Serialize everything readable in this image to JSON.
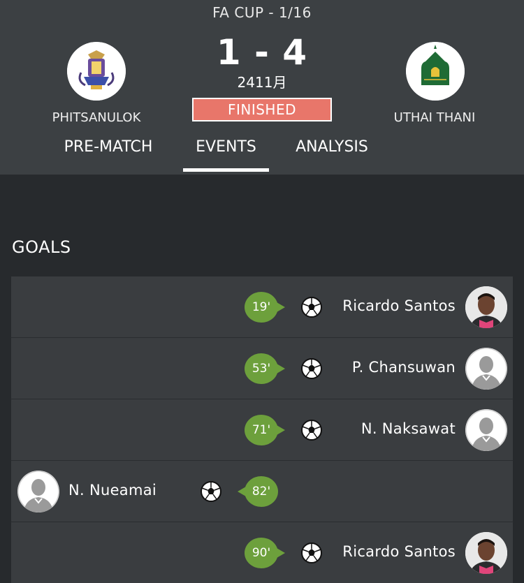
{
  "header": {
    "competition": "FA CUP - 1/16",
    "score": "1 - 4",
    "date": "2411月",
    "status": "FINISHED",
    "home_team": "PHITSANULOK",
    "away_team": "UTHAI THANI"
  },
  "tabs": [
    {
      "label": "PRE-MATCH"
    },
    {
      "label": "EVENTS",
      "active": true
    },
    {
      "label": "ANALYSIS"
    }
  ],
  "goals_title": "GOALS",
  "goals": [
    {
      "minute": "19'",
      "player": "Ricardo Santos",
      "side": "away",
      "avatar": "player-photo"
    },
    {
      "minute": "53'",
      "player": "P. Chansuwan",
      "side": "away",
      "avatar": "placeholder"
    },
    {
      "minute": "71'",
      "player": "N. Naksawat",
      "side": "away",
      "avatar": "placeholder"
    },
    {
      "minute": "82'",
      "player": "N. Nueamai",
      "side": "home",
      "avatar": "placeholder"
    },
    {
      "minute": "90'",
      "player": "Ricardo Santos",
      "side": "away",
      "avatar": "player-photo"
    }
  ],
  "colors": {
    "header_bg": "#3c4043",
    "body_bg": "#272a2d",
    "row_bg": "#3a3d40",
    "finished_badge": "#e8766a",
    "minute_badge": "#6da03c"
  }
}
